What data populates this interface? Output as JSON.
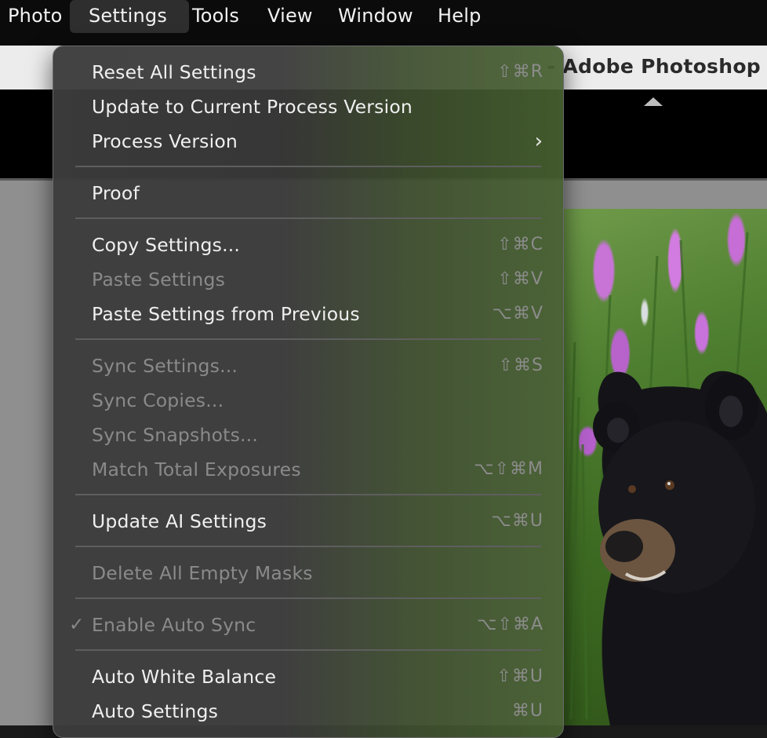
{
  "menubar": {
    "items": [
      "Photo",
      "Settings",
      "Tools",
      "View",
      "Window",
      "Help"
    ],
    "active": "Settings"
  },
  "window": {
    "title_suffix": "- Adobe Photoshop"
  },
  "colors": {
    "menubar_bg": "#0b0b0b",
    "menu_bg": "#3a3a3a",
    "text_enabled": "#f0f0f0",
    "text_disabled": "#8a8a8a",
    "separator": "#5e5e5e"
  },
  "settings_menu": {
    "items": [
      {
        "label": "Reset All Settings",
        "shortcut": "⇧⌘R",
        "enabled": true
      },
      {
        "label": "Update to Current Process Version",
        "shortcut": "",
        "enabled": true
      },
      {
        "label": "Process Version",
        "shortcut": "",
        "enabled": true,
        "submenu_icon": "chevron-right-icon"
      },
      {
        "label": "Proof",
        "shortcut": "",
        "enabled": true
      },
      {
        "label": "Copy Settings...",
        "shortcut": "⇧⌘C",
        "enabled": true
      },
      {
        "label": "Paste Settings",
        "shortcut": "⇧⌘V",
        "enabled": false
      },
      {
        "label": "Paste Settings from Previous",
        "shortcut": "⌥⌘V",
        "enabled": true
      },
      {
        "label": "Sync Settings...",
        "shortcut": "⇧⌘S",
        "enabled": false
      },
      {
        "label": "Sync Copies...",
        "shortcut": "",
        "enabled": false
      },
      {
        "label": "Sync Snapshots...",
        "shortcut": "",
        "enabled": false
      },
      {
        "label": "Match Total Exposures",
        "shortcut": "⌥⇧⌘M",
        "enabled": false
      },
      {
        "label": "Update AI Settings",
        "shortcut": "⌥⌘U",
        "enabled": true
      },
      {
        "label": "Delete All Empty Masks",
        "shortcut": "",
        "enabled": false
      },
      {
        "label": "Enable Auto Sync",
        "shortcut": "⌥⇧⌘A",
        "enabled": false,
        "checked": true,
        "check_icon": "checkmark-icon"
      },
      {
        "label": "Auto White Balance",
        "shortcut": "⇧⌘U",
        "enabled": true
      },
      {
        "label": "Auto Settings",
        "shortcut": "⌘U",
        "enabled": true
      }
    ]
  }
}
